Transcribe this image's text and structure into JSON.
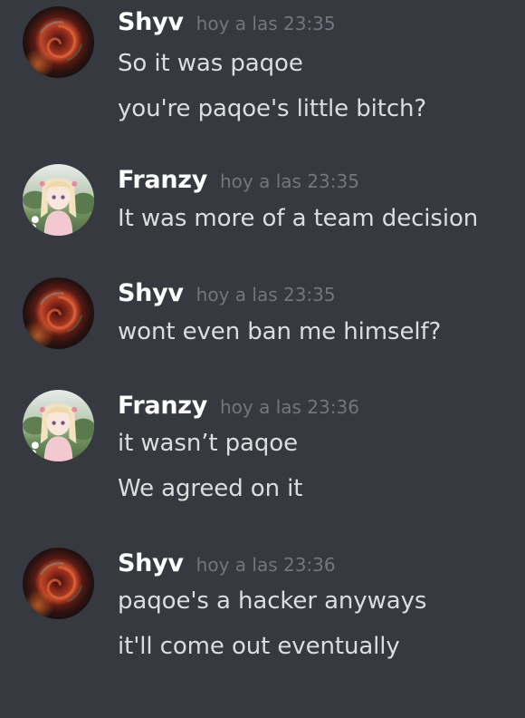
{
  "messages": [
    {
      "author": "Shyv",
      "avatar": "dark-red-rose-avatar",
      "timestamp": "hoy a las 23:35",
      "lines": [
        "So it was paqoe",
        "you're paqoe's little bitch?"
      ]
    },
    {
      "author": "Franzy",
      "avatar": "anime-girl-avatar",
      "timestamp": "hoy a las 23:35",
      "lines": [
        "It was more of a team decision"
      ]
    },
    {
      "author": "Shyv",
      "avatar": "dark-red-rose-avatar",
      "timestamp": "hoy a las 23:35",
      "lines": [
        "wont even ban me himself?"
      ]
    },
    {
      "author": "Franzy",
      "avatar": "anime-girl-avatar",
      "timestamp": "hoy a las 23:36",
      "lines": [
        "it wasn’t paqoe",
        "We agreed on it"
      ]
    },
    {
      "author": "Shyv",
      "avatar": "dark-red-rose-avatar",
      "timestamp": "hoy a las 23:36",
      "lines": [
        "paqoe's a hacker anyways",
        "it'll come out eventually"
      ]
    }
  ],
  "colors": {
    "background": "#36393f",
    "username": "#ffffff",
    "timestamp": "#72767d",
    "message_text": "#dcddde"
  }
}
